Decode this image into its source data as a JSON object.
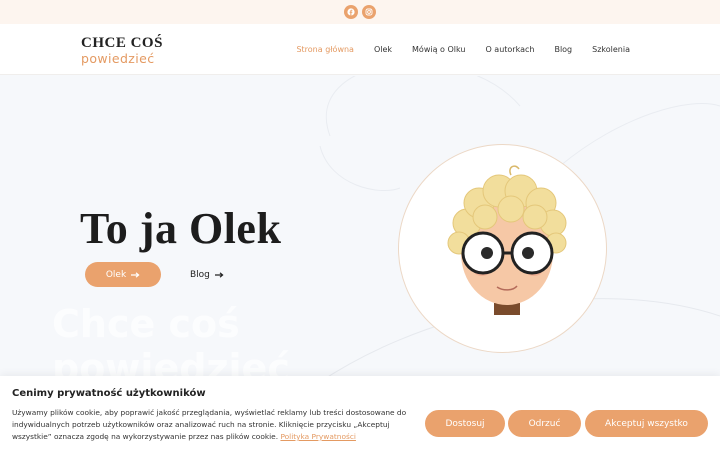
{
  "topbar": {
    "icons": [
      "facebook-icon",
      "instagram-icon"
    ],
    "icon_color": "#eaa26d"
  },
  "header": {
    "logo_line1": "CHCE COŚ",
    "logo_line2": "powiedzieć",
    "nav": [
      {
        "label": "Strona główna",
        "active": true
      },
      {
        "label": "Olek",
        "active": false
      },
      {
        "label": "Mówią o Olku",
        "active": false
      },
      {
        "label": "O autorkach",
        "active": false
      },
      {
        "label": "Blog",
        "active": false
      },
      {
        "label": "Szkolenia",
        "active": false
      }
    ]
  },
  "hero": {
    "title": "To ja Olek",
    "primary_button": "Olek",
    "secondary_button": "Blog",
    "watermark_line1": "Chce coś",
    "watermark_line2": "powiedzieć",
    "avatar_icon": "boy-with-glasses-illustration"
  },
  "cookie": {
    "title": "Cenimy prywatność użytkowników",
    "text": "Używamy plików cookie, aby poprawić jakość przeglądania, wyświetlać reklamy lub treści dostosowane do indywidualnych potrzeb użytkowników oraz analizować ruch na stronie. Kliknięcie przycisku „Akceptuj wszystkie” oznacza zgodę na wykorzystywanie przez nas plików cookie.",
    "link": "Polityka Prywatności",
    "buttons": {
      "customize": "Dostosuj",
      "reject": "Odrzuć",
      "accept": "Akceptuj wszystko"
    }
  },
  "colors": {
    "accent": "#eaa26d",
    "accent_text": "#e49a62",
    "background": "#f6f8fb",
    "topbar": "#fdf5ef"
  }
}
